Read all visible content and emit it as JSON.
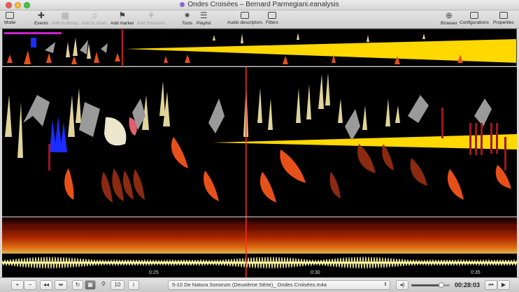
{
  "window": {
    "title": "Ondes Croisées – Bernard Parmegiani.eanalysis"
  },
  "toolbar": {
    "mode": "Mode",
    "events": "Events",
    "add_to_library": "Add to library",
    "add_to_chart": "Add to chart",
    "add_marker": "Add marker",
    "add_structure": "Add Structure",
    "tools": "Tools",
    "playlist": "Playlist",
    "audio_descriptors": "Audio descriptors",
    "filters": "Filters",
    "browser": "Browser",
    "configurations": "Configurations",
    "properties": "Properties"
  },
  "timeline": {
    "ticks": [
      "0:25",
      "0:30",
      "0:35"
    ]
  },
  "bottom": {
    "zoom_in": "+",
    "zoom_out": "−",
    "zoom_value": "10",
    "info": "i",
    "track": "5-10 De Natura Sonorum (Deuxième Série)_ Ondes Croisées.m4a",
    "time": "00:28:03",
    "volume_level": 0.78
  },
  "colors": {
    "yellow": "#ffd800",
    "khaki": "#e0d49a",
    "grey": "#9a9a9a",
    "orange": "#e8501a",
    "brown": "#8a2a10",
    "darkred": "#a0161c",
    "blue": "#1a2cff",
    "cream": "#ece6cc",
    "pink": "#e06070",
    "playhead": "#ff2a2a"
  }
}
